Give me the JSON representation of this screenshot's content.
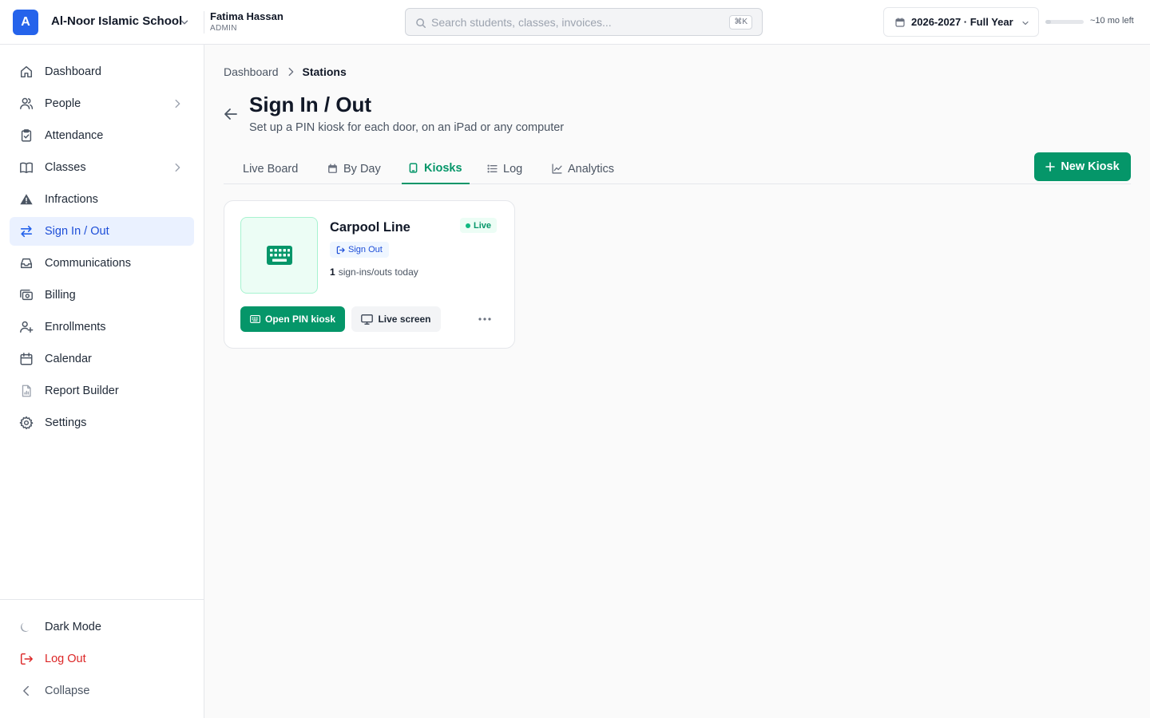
{
  "topbar": {
    "logo_letter": "A",
    "school_name": "Al-Noor Islamic School",
    "user_name": "Fatima Hassan",
    "user_role": "ADMIN",
    "search_placeholder": "Search students, classes, invoices...",
    "search_shortcut": "⌘K",
    "year_label": "2026-2027 · Full Year",
    "term_remaining": "~10 mo left",
    "term_progress_fraction": 0.15
  },
  "sidebar": {
    "items": [
      {
        "label": "Dashboard",
        "icon": "home-icon"
      },
      {
        "label": "People",
        "icon": "users-icon",
        "expandable": true
      },
      {
        "label": "Attendance",
        "icon": "clipboard-check-icon"
      },
      {
        "label": "Classes",
        "icon": "book-icon",
        "expandable": true
      },
      {
        "label": "Infractions",
        "icon": "warning-icon"
      },
      {
        "label": "Sign In / Out",
        "icon": "swap-arrows-icon",
        "active": true
      },
      {
        "label": "Communications",
        "icon": "inbox-icon"
      },
      {
        "label": "Billing",
        "icon": "billing-icon"
      },
      {
        "label": "Enrollments",
        "icon": "user-plus-icon"
      },
      {
        "label": "Calendar",
        "icon": "calendar-icon"
      },
      {
        "label": "Report Builder",
        "icon": "report-icon"
      },
      {
        "label": "Settings",
        "icon": "gear-icon"
      }
    ],
    "bottom": {
      "dark_mode": "Dark Mode",
      "logout": "Log Out",
      "collapse": "Collapse"
    }
  },
  "main": {
    "breadcrumb": {
      "parent": "Dashboard",
      "current": "Stations"
    },
    "title": "Sign In / Out",
    "subtitle": "Set up a PIN kiosk for each door, on an iPad or any computer",
    "tabs": [
      {
        "label": "Live Board"
      },
      {
        "label": "By Day",
        "icon": "calendar-icon"
      },
      {
        "label": "Kiosks",
        "icon": "tablet-icon",
        "active": true
      },
      {
        "label": "Log",
        "icon": "list-icon"
      },
      {
        "label": "Analytics",
        "icon": "chart-line-icon"
      }
    ],
    "new_kiosk_label": "New Kiosk"
  },
  "kiosk": {
    "name": "Carpool Line",
    "status": "Live",
    "mode": "Sign Out",
    "count": "1",
    "count_suffix": "sign-ins/outs today",
    "open_pin_label": "Open PIN kiosk",
    "live_screen_label": "Live screen"
  },
  "colors": {
    "accent_green": "#059669",
    "brand_blue": "#2563eb",
    "active_nav_bg": "#eaf1ff",
    "danger_red": "#dc2626"
  }
}
